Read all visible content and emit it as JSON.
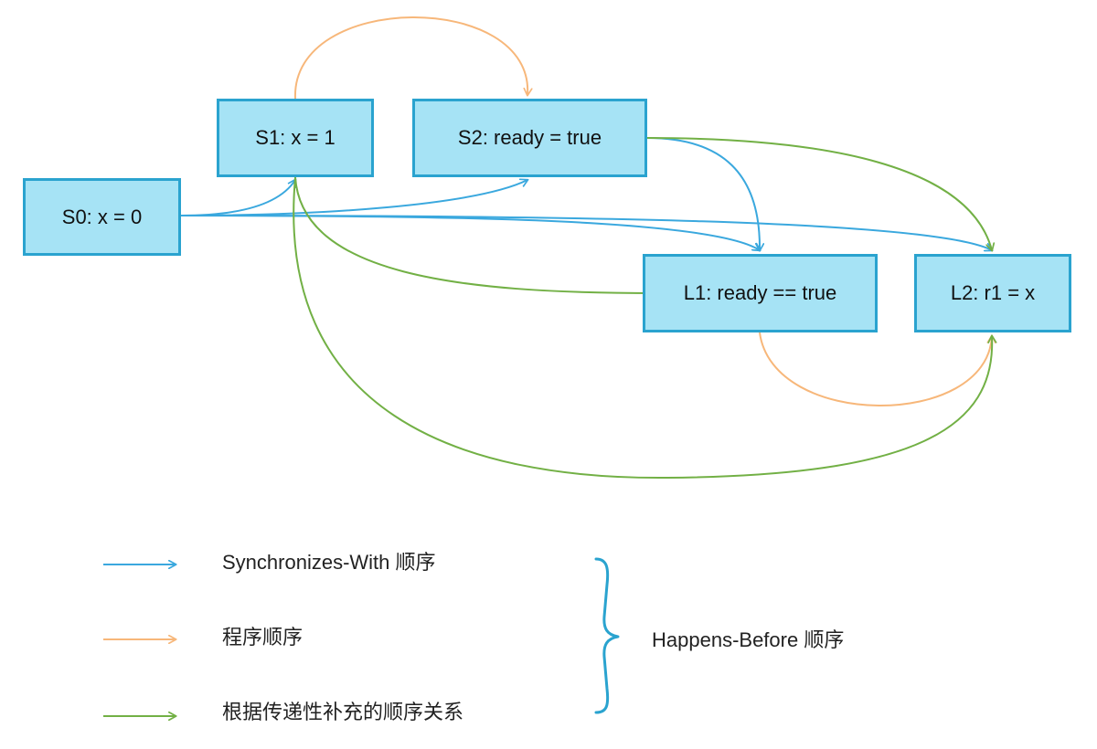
{
  "diagram": {
    "nodes": [
      {
        "id": "s0",
        "label": "S0: x = 0"
      },
      {
        "id": "s1",
        "label": "S1: x = 1"
      },
      {
        "id": "s2",
        "label": "S2: ready = true"
      },
      {
        "id": "l1",
        "label": "L1: ready == true"
      },
      {
        "id": "l2",
        "label": "L2: r1 = x"
      }
    ],
    "edges": [
      {
        "from": "s1",
        "to": "s2",
        "kind": "program-order"
      },
      {
        "from": "l1",
        "to": "l2",
        "kind": "program-order"
      },
      {
        "from": "s0",
        "to": "s1",
        "kind": "synchronizes-with"
      },
      {
        "from": "s0",
        "to": "s2",
        "kind": "synchronizes-with"
      },
      {
        "from": "s0",
        "to": "l1",
        "kind": "synchronizes-with"
      },
      {
        "from": "s0",
        "to": "l2",
        "kind": "synchronizes-with"
      },
      {
        "from": "s2",
        "to": "l1",
        "kind": "synchronizes-with"
      },
      {
        "from": "s2",
        "to": "l2",
        "kind": "transitive"
      },
      {
        "from": "s1",
        "to": "l1",
        "kind": "transitive"
      },
      {
        "from": "s1",
        "to": "l2",
        "kind": "transitive"
      }
    ]
  },
  "legend": {
    "synchronizes_with": "Synchronizes-With 顺序",
    "program_order": "程序顺序",
    "transitive": "根据传递性补充的顺序关系",
    "happens_before": "Happens-Before 顺序"
  },
  "colors": {
    "synchronizes_with": "#3aa8de",
    "program_order": "#f7b77a",
    "transitive": "#72b045",
    "node_fill": "#a6e3f5",
    "node_border": "#2aa3cf",
    "brace": "#2aa3cf"
  }
}
